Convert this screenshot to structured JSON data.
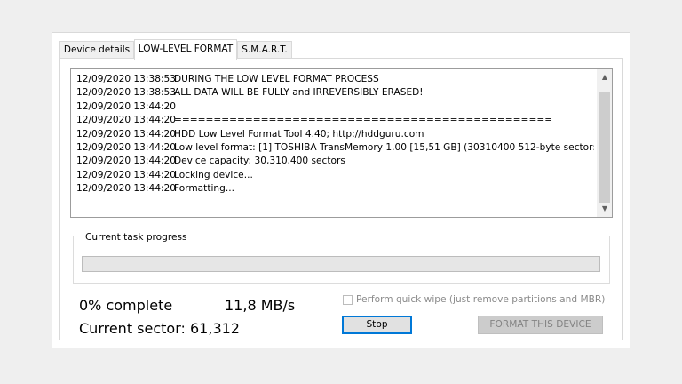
{
  "tabs": [
    {
      "label": "Device details"
    },
    {
      "label": "LOW-LEVEL FORMAT"
    },
    {
      "label": "S.M.A.R.T."
    }
  ],
  "log": [
    {
      "time": "12/09/2020 13:38:53",
      "text": "DURING THE LOW LEVEL FORMAT PROCESS"
    },
    {
      "time": "12/09/2020 13:38:53",
      "text": "ALL DATA WILL BE FULLY and IRREVERSIBLY ERASED!"
    },
    {
      "time": "12/09/2020 13:44:20",
      "text": ""
    },
    {
      "time": "12/09/2020 13:44:20",
      "text": "================================================"
    },
    {
      "time": "12/09/2020 13:44:20",
      "text": "HDD Low Level Format Tool 4.40; http://hddguru.com"
    },
    {
      "time": "12/09/2020 13:44:20",
      "text": "Low level format: [1]  TOSHIBA TransMemory    1.00    [15,51 GB]    (30310400 512-byte sector:"
    },
    {
      "time": "12/09/2020 13:44:20",
      "text": "Device capacity: 30,310,400 sectors"
    },
    {
      "time": "12/09/2020 13:44:20",
      "text": "Locking device..."
    },
    {
      "time": "12/09/2020 13:44:20",
      "text": "Formatting..."
    }
  ],
  "progress": {
    "label": "Current task progress",
    "value": 0
  },
  "status": {
    "percent_text": "0% complete",
    "speed": "11,8 MB/s",
    "sector_text": "Current sector: 61,312"
  },
  "quick_wipe": {
    "label": "Perform quick wipe (just remove partitions and MBR)",
    "checked": false
  },
  "buttons": {
    "stop": "Stop",
    "format": "FORMAT THIS DEVICE"
  },
  "colors": {
    "progress_fill": "#06b025",
    "focus_border": "#0078d7"
  },
  "icons": {
    "scroll_up": "chevron-up-icon",
    "scroll_down": "chevron-down-icon"
  }
}
